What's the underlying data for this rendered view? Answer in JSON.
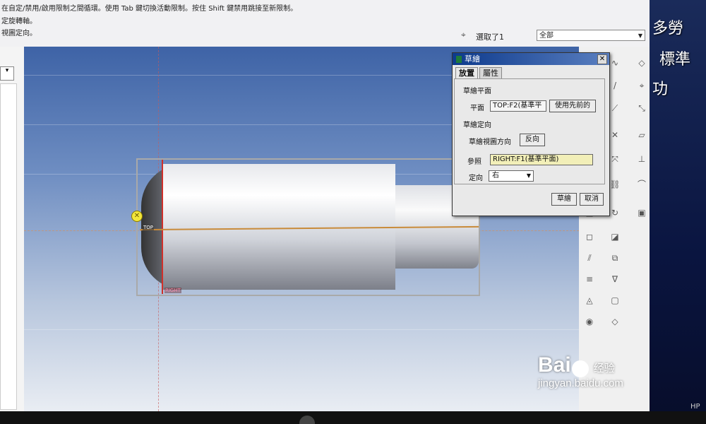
{
  "message_area": {
    "lines": [
      "在自定/禁用/啟用限制之間循環。使用 Tab 鍵切換活動限制。按住 Shift 鍵禁用跳接至新限制。",
      "定旋轉軸。",
      "視圖定向。"
    ]
  },
  "selection": {
    "icon": "filter-icon",
    "count_text": "選取了1",
    "filter_value": "全部"
  },
  "viewport": {
    "datum_labels": {
      "top": "TOP",
      "right": "RIGHT"
    }
  },
  "sketch_dialog": {
    "title": "草繪",
    "tabs": [
      {
        "label": "放置",
        "active": true
      },
      {
        "label": "屬性",
        "active": false
      }
    ],
    "section_plane": "草繪平面",
    "plane_label": "平面",
    "plane_value": "TOP:F2(基準平",
    "use_previous_button": "使用先前的",
    "section_orientation": "草繪定向",
    "view_direction_label": "草繪視圖方向",
    "flip_button": "反向",
    "reference_label": "參照",
    "reference_value": "RIGHT:F1(基準平面)",
    "orientation_label": "定向",
    "orientation_value": "右",
    "sketch_button": "草繪",
    "cancel_button": "取消"
  },
  "side_text": [
    "多勞",
    "標準",
    "功"
  ],
  "watermark": {
    "brand": "Bai",
    "brand_cn": "经验",
    "url": "jingyan.baidu.com"
  },
  "monitor": {
    "brand": "HP"
  },
  "colors": {
    "title_bar": "#0d3a8c",
    "reference_field": "#f2efb8",
    "datum_red": "#d0302a",
    "pivot_yellow": "#f2e63a"
  }
}
